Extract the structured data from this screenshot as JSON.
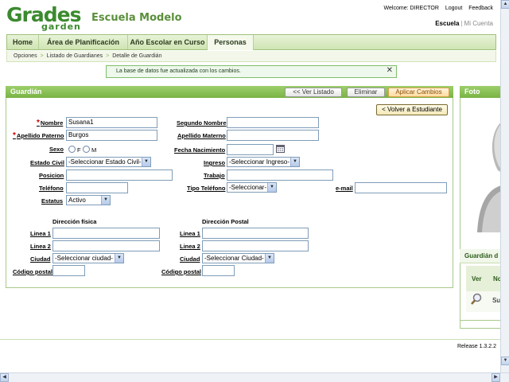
{
  "header": {
    "logo_main": "Grades",
    "logo_sub": "garden",
    "school": "Escuela Modelo",
    "welcome": "Welcome: DIRECTOR",
    "logout": "Logout",
    "feedback": "Feedback",
    "links": [
      "Escuela",
      "Mi Cuenta"
    ]
  },
  "nav": {
    "tabs": [
      "Home",
      "Área de Planificación",
      "Año Escolar en Curso",
      "Personas"
    ],
    "active": "Personas"
  },
  "breadcrumb": [
    "Opciones",
    "Listado de Guardianes",
    "Detalle de Guardián"
  ],
  "message": "La base de datos fue actualizada con los cambios.",
  "form": {
    "title": "Guardián",
    "buttons": {
      "list": "<< Ver Listado",
      "delete": "Eliminar",
      "apply": "Aplicar Cambios",
      "back": "< Volver a Estudiante"
    },
    "labels": {
      "nombre": "Nombre",
      "segundo_nombre": "Segundo Nombre",
      "apellido_paterno": "Apellido Paterno",
      "apellido_materno": "Apellido Materno",
      "sexo": "Sexo",
      "fecha_nacimiento": "Fecha Nacimiento",
      "estado_civil": "Estado Civil",
      "ingreso": "Ingreso",
      "posicion": "Posicion",
      "trabajo": "Trabajo",
      "telefono": "Teléfono",
      "tipo_telefono": "Tipo Teléfono",
      "email": "e-mail",
      "estatus": "Estatus",
      "sexo_f": "F",
      "sexo_m": "M"
    },
    "values": {
      "nombre": "Susana1",
      "segundo_nombre": "",
      "apellido_paterno": "Burgos",
      "apellido_materno": "",
      "fecha_nacimiento": "",
      "estado_civil": "-Seleccionar Estado Civil-",
      "ingreso": "-Seleccionar Ingreso-",
      "posicion": "",
      "trabajo": "",
      "telefono": "",
      "tipo_telefono": "-Seleccionar-",
      "email": "",
      "estatus": "Activo"
    },
    "address": {
      "fisica_title": "Dirección física",
      "postal_title": "Dirección Postal",
      "linea1": "Linea 1",
      "linea2": "Linea 2",
      "ciudad": "Ciudad",
      "codigo_postal": "Código postal",
      "ciudad_fisica": "-Seleccionar ciudad-",
      "ciudad_postal": "-Seleccionar Ciudad-"
    }
  },
  "right": {
    "foto_title": "Foto",
    "guardian_title": "Guardián d",
    "col_ver": "Ver",
    "col_no": "No",
    "row_name": "Su"
  },
  "footer": {
    "release": "Release 1.3.2.2"
  },
  "colors": {
    "accent": "#79b344",
    "brand": "#3b8a2e",
    "message_bg": "#eef8ec",
    "required": "#cc0000"
  }
}
